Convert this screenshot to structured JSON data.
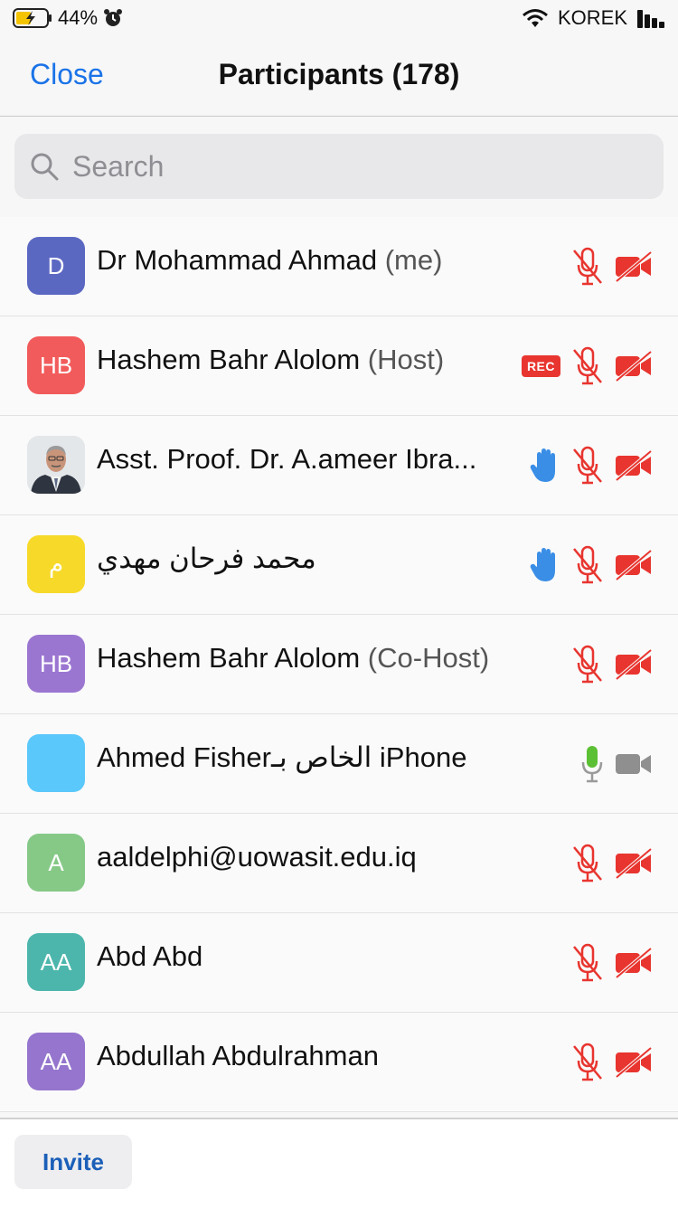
{
  "status": {
    "battery": "44%",
    "carrier": "KOREK"
  },
  "nav": {
    "close": "Close",
    "title": "Participants (178)"
  },
  "search": {
    "placeholder": "Search"
  },
  "participants": [
    {
      "initials": "D",
      "color": "#5b68c2",
      "name": "Dr Mohammad Ahmad",
      "role": " (me)",
      "rec": false,
      "hand": false,
      "mic": "muted",
      "video": "off"
    },
    {
      "initials": "HB",
      "color": "#f25b5b",
      "name": "Hashem Bahr Alolom",
      "role": " (Host)",
      "rec": true,
      "rec_label": "REC",
      "hand": false,
      "mic": "muted",
      "video": "off"
    },
    {
      "initials": "",
      "color": "#dfe3e8",
      "photo": true,
      "name": "Asst. Proof. Dr. A.ameer Ibra...",
      "role": "",
      "rec": false,
      "hand": true,
      "mic": "muted",
      "video": "off"
    },
    {
      "initials": "م",
      "color": "#f7d92a",
      "name": "محمد فرحان مهدي",
      "role": "",
      "rec": false,
      "hand": true,
      "mic": "muted",
      "video": "off"
    },
    {
      "initials": "HB",
      "color": "#9b76d1",
      "name": "Hashem Bahr Alolom",
      "role": " (Co-Host)",
      "rec": false,
      "hand": false,
      "mic": "muted",
      "video": "off"
    },
    {
      "initials": "",
      "color": "#5ac8fa",
      "name": "Ahmed Fisherالخاص بـ iPhone",
      "role": "",
      "rec": false,
      "hand": false,
      "mic": "active",
      "video": "idle"
    },
    {
      "initials": "A",
      "color": "#86c987",
      "name": "aaldelphi@uowasit.edu.iq",
      "role": "",
      "rec": false,
      "hand": false,
      "mic": "muted",
      "video": "off"
    },
    {
      "initials": "AA",
      "color": "#4db6ac",
      "name": "Abd Abd",
      "role": "",
      "rec": false,
      "hand": false,
      "mic": "muted",
      "video": "off"
    },
    {
      "initials": "AA",
      "color": "#9575cd",
      "name": "Abdullah Abdulrahman",
      "role": "",
      "rec": false,
      "hand": false,
      "mic": "muted",
      "video": "off"
    }
  ],
  "footer": {
    "invite": "Invite"
  },
  "colors": {
    "accent": "#1b73e8",
    "muted_red": "#e8352f",
    "active_green": "#5cc034",
    "hand_blue": "#3a8ee6"
  }
}
